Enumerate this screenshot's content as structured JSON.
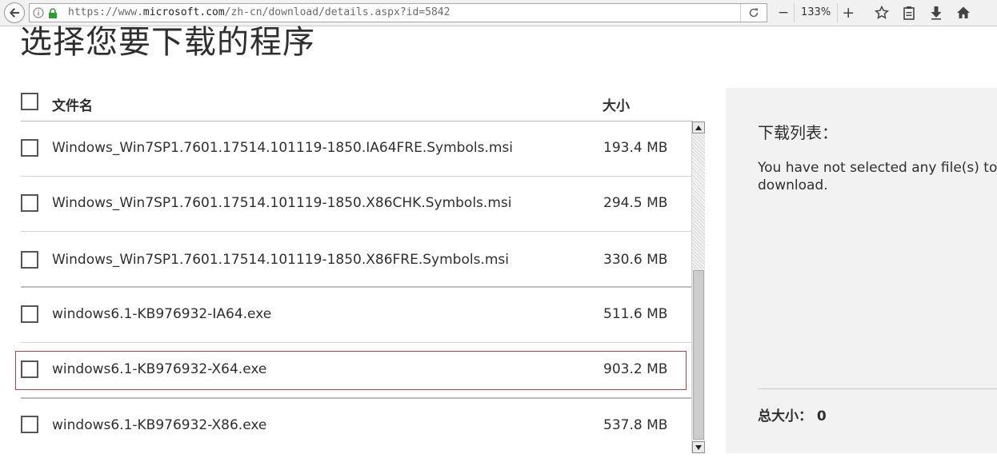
{
  "browser": {
    "url_prefix": "https://www.",
    "url_domain": "microsoft.com",
    "url_suffix": "/zh-cn/download/details.aspx?id=5842",
    "zoom": "133%",
    "zoom_out_label": "−",
    "zoom_in_label": "+"
  },
  "page": {
    "title": "选择您要下载的程序",
    "header": {
      "name_label": "文件名",
      "size_label": "大小"
    },
    "files": [
      {
        "name": "Windows_Win7SP1.7601.17514.101119-1850.IA64FRE.Symbols.msi",
        "size": "193.4 MB"
      },
      {
        "name": "Windows_Win7SP1.7601.17514.101119-1850.X86CHK.Symbols.msi",
        "size": "294.5 MB"
      },
      {
        "name": "Windows_Win7SP1.7601.17514.101119-1850.X86FRE.Symbols.msi",
        "size": "330.6 MB"
      },
      {
        "name": "windows6.1-KB976932-IA64.exe",
        "size": "511.6 MB"
      },
      {
        "name": "windows6.1-KB976932-X64.exe",
        "size": "903.2 MB"
      },
      {
        "name": "windows6.1-KB976932-X86.exe",
        "size": "537.8 MB"
      }
    ]
  },
  "sidebar": {
    "title": "下载列表：",
    "message": "You have not selected any file(s) to download.",
    "total_label": "总大小：",
    "total_value": "0"
  },
  "colors": {
    "highlight": "#c8383f",
    "panel_bg": "#f2f2f2"
  }
}
